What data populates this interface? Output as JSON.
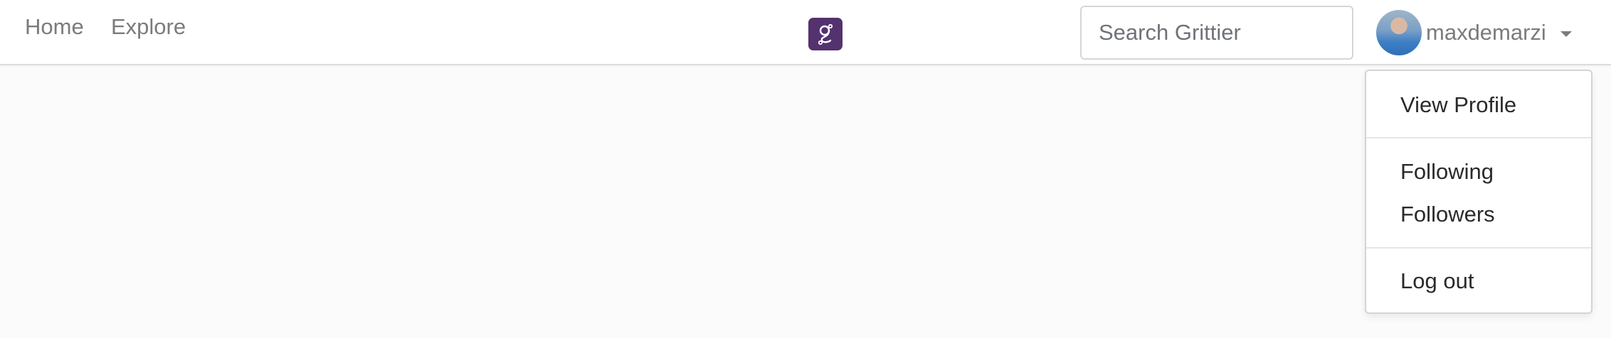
{
  "navbar": {
    "links": [
      {
        "label": "Home"
      },
      {
        "label": "Explore"
      }
    ],
    "logo": {
      "icon": "grittier-logo-icon",
      "color": "#54316f"
    },
    "search": {
      "placeholder": "Search Grittier",
      "value": ""
    },
    "user": {
      "username": "maxdemarzi",
      "avatar": "user-avatar"
    }
  },
  "dropdown": {
    "items": [
      {
        "label": "View Profile"
      },
      {
        "label": "Following"
      },
      {
        "label": "Followers"
      },
      {
        "label": "Log out"
      }
    ]
  },
  "colors": {
    "page_background": "#fbfbfb",
    "brand": "#54316f",
    "nav_text": "#7b7b7b",
    "menu_text": "#2a2a2a"
  }
}
